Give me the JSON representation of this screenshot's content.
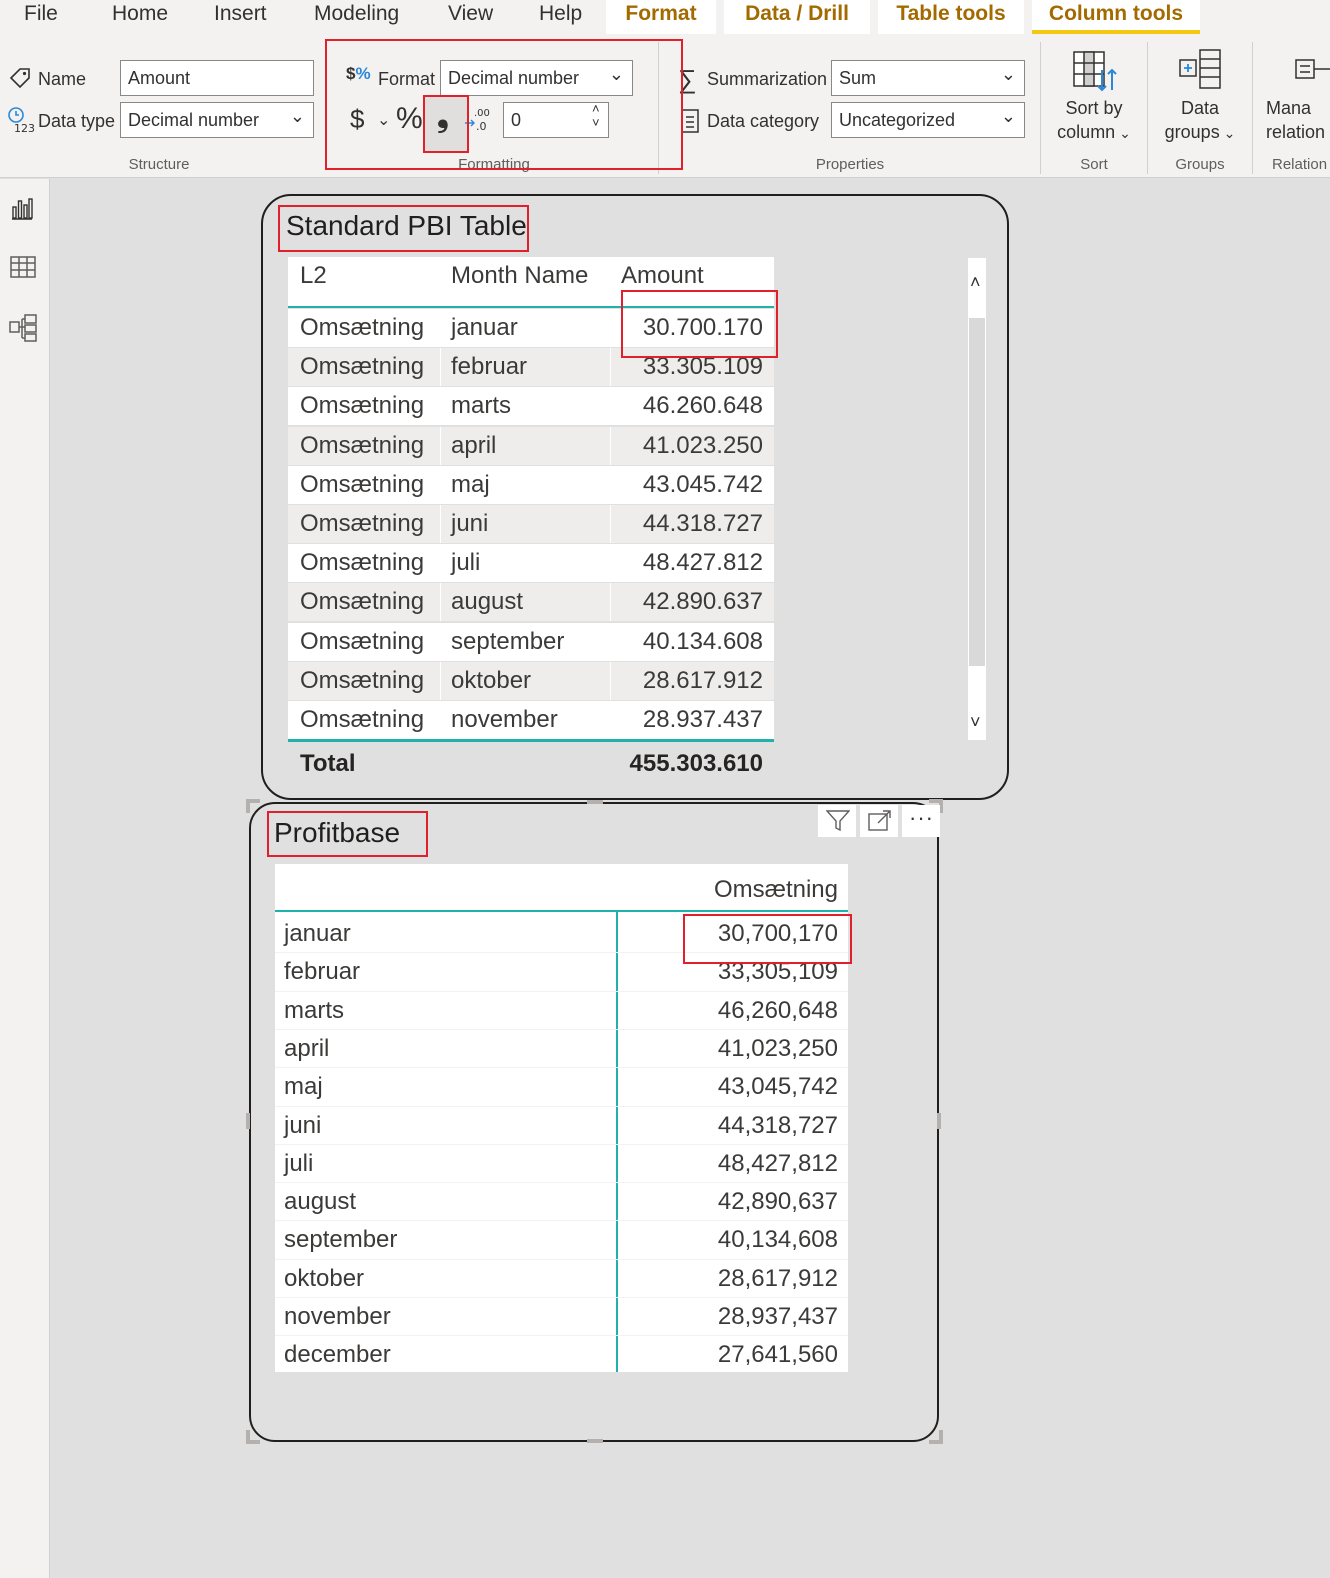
{
  "menu": {
    "items": [
      "File",
      "Home",
      "Insert",
      "Modeling",
      "View",
      "Help"
    ],
    "context_tabs": [
      "Format",
      "Data / Drill",
      "Table tools",
      "Column tools"
    ],
    "active_tab": "Column tools"
  },
  "ribbon": {
    "structure": {
      "name_label": "Name",
      "name_value": "Amount",
      "datatype_label": "Data type",
      "datatype_value": "Decimal number",
      "group": "Structure"
    },
    "formatting": {
      "format_label": "Format",
      "format_value": "Decimal number",
      "currency_symbol": "$",
      "percent_symbol": "%",
      "comma_symbol": "❟",
      "decimals_value": "0",
      "group": "Formatting"
    },
    "properties": {
      "summarization_label": "Summarization",
      "summarization_value": "Sum",
      "category_label": "Data category",
      "category_value": "Uncategorized",
      "group": "Properties"
    },
    "sort": {
      "button_line1": "Sort by",
      "button_line2": "column",
      "group": "Sort"
    },
    "groups": {
      "button_line1": "Data",
      "button_line2": "groups",
      "group": "Groups"
    },
    "relationships": {
      "button_line1": "Mana",
      "button_line2": "relation",
      "group": "Relation"
    }
  },
  "rail": {
    "icons": [
      "report-view-icon",
      "data-view-icon",
      "model-view-icon"
    ]
  },
  "standard_table": {
    "title": "Standard PBI Table",
    "headers": [
      "L2",
      "Month Name",
      "Amount"
    ],
    "rows": [
      [
        "Omsætning",
        "januar",
        "30.700.170"
      ],
      [
        "Omsætning",
        "februar",
        "33.305.109"
      ],
      [
        "Omsætning",
        "marts",
        "46.260.648"
      ],
      [
        "Omsætning",
        "april",
        "41.023.250"
      ],
      [
        "Omsætning",
        "maj",
        "43.045.742"
      ],
      [
        "Omsætning",
        "juni",
        "44.318.727"
      ],
      [
        "Omsætning",
        "juli",
        "48.427.812"
      ],
      [
        "Omsætning",
        "august",
        "42.890.637"
      ],
      [
        "Omsætning",
        "september",
        "40.134.608"
      ],
      [
        "Omsætning",
        "oktober",
        "28.617.912"
      ],
      [
        "Omsætning",
        "november",
        "28.937.437"
      ]
    ],
    "total_label": "Total",
    "total_value": "455.303.610"
  },
  "profitbase": {
    "title": "Profitbase",
    "column_header": "Omsætning",
    "rows": [
      [
        "januar",
        "30,700,170"
      ],
      [
        "februar",
        "33,305,109"
      ],
      [
        "marts",
        "46,260,648"
      ],
      [
        "april",
        "41,023,250"
      ],
      [
        "maj",
        "43,045,742"
      ],
      [
        "juni",
        "44,318,727"
      ],
      [
        "juli",
        "48,427,812"
      ],
      [
        "august",
        "42,890,637"
      ],
      [
        "september",
        "40,134,608"
      ],
      [
        "oktober",
        "28,617,912"
      ],
      [
        "november",
        "28,937,437"
      ],
      [
        "december",
        "27,641,560"
      ]
    ],
    "header_icons": [
      "filter-icon",
      "focus-mode-icon",
      "more-options-icon"
    ]
  },
  "colors": {
    "accent": "#f2c811",
    "context_tab_text": "#a36a00",
    "highlight_box": "#e0202a",
    "table_rule": "#20b2aa"
  }
}
